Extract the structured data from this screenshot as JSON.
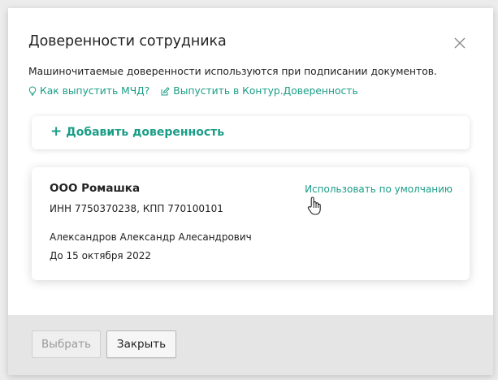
{
  "dialog": {
    "title": "Доверенности сотрудника",
    "description": "Машиночитаемые доверенности используются при подписании документов.",
    "links": [
      {
        "label": "Как выпустить МЧД?",
        "icon": "lightbulb-icon"
      },
      {
        "label": "Выпустить в Контур.Доверенность",
        "icon": "external-edit-icon"
      }
    ],
    "close_icon": "close-icon"
  },
  "add_card": {
    "label": "Добавить доверенность",
    "icon_glyph": "+"
  },
  "poa": {
    "organization": "ООО Ромашка",
    "requisites": "ИНН 7750370238, КПП 770100101",
    "representative": "Александров Александр Алесандрович",
    "valid_until": "До 15 октября 2022",
    "default_action": "Использовать по умолчанию"
  },
  "footer": {
    "select_label": "Выбрать",
    "close_label": "Закрыть"
  },
  "colors": {
    "accent": "#1a9d86",
    "text": "#222222",
    "footer_bg": "#e5e5e5"
  }
}
